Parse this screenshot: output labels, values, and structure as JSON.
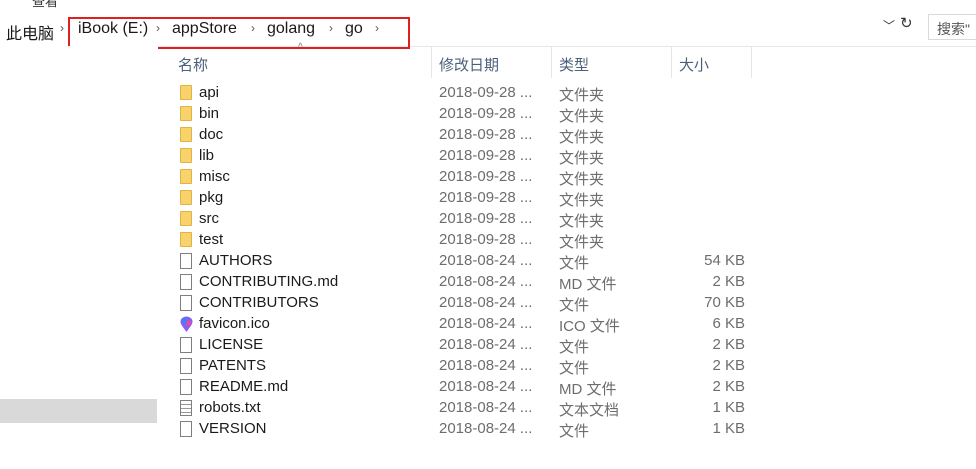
{
  "window": {
    "fragment": "查看"
  },
  "address": {
    "crumbs": [
      "此电脑",
      "iBook (E:)",
      "appStore",
      "golang",
      "go"
    ],
    "search_placeholder": "搜索\""
  },
  "columns": {
    "name": "名称",
    "date": "修改日期",
    "type": "类型",
    "size": "大小"
  },
  "files": [
    {
      "name": "api",
      "date": "2018-09-28 ...",
      "type": "文件夹",
      "size": "",
      "kind": "folder"
    },
    {
      "name": "bin",
      "date": "2018-09-28 ...",
      "type": "文件夹",
      "size": "",
      "kind": "folder"
    },
    {
      "name": "doc",
      "date": "2018-09-28 ...",
      "type": "文件夹",
      "size": "",
      "kind": "folder"
    },
    {
      "name": "lib",
      "date": "2018-09-28 ...",
      "type": "文件夹",
      "size": "",
      "kind": "folder"
    },
    {
      "name": "misc",
      "date": "2018-09-28 ...",
      "type": "文件夹",
      "size": "",
      "kind": "folder"
    },
    {
      "name": "pkg",
      "date": "2018-09-28 ...",
      "type": "文件夹",
      "size": "",
      "kind": "folder"
    },
    {
      "name": "src",
      "date": "2018-09-28 ...",
      "type": "文件夹",
      "size": "",
      "kind": "folder"
    },
    {
      "name": "test",
      "date": "2018-09-28 ...",
      "type": "文件夹",
      "size": "",
      "kind": "folder"
    },
    {
      "name": "AUTHORS",
      "date": "2018-08-24 ...",
      "type": "文件",
      "size": "54 KB",
      "kind": "file"
    },
    {
      "name": "CONTRIBUTING.md",
      "date": "2018-08-24 ...",
      "type": "MD 文件",
      "size": "2 KB",
      "kind": "file"
    },
    {
      "name": "CONTRIBUTORS",
      "date": "2018-08-24 ...",
      "type": "文件",
      "size": "70 KB",
      "kind": "file"
    },
    {
      "name": "favicon.ico",
      "date": "2018-08-24 ...",
      "type": "ICO 文件",
      "size": "6 KB",
      "kind": "ico"
    },
    {
      "name": "LICENSE",
      "date": "2018-08-24 ...",
      "type": "文件",
      "size": "2 KB",
      "kind": "file"
    },
    {
      "name": "PATENTS",
      "date": "2018-08-24 ...",
      "type": "文件",
      "size": "2 KB",
      "kind": "file"
    },
    {
      "name": "README.md",
      "date": "2018-08-24 ...",
      "type": "MD 文件",
      "size": "2 KB",
      "kind": "file"
    },
    {
      "name": "robots.txt",
      "date": "2018-08-24 ...",
      "type": "文本文档",
      "size": "1 KB",
      "kind": "txt"
    },
    {
      "name": "VERSION",
      "date": "2018-08-24 ...",
      "type": "文件",
      "size": "1 KB",
      "kind": "file"
    }
  ],
  "colors": {
    "highlight_border": "#e02020",
    "folder": "#f8d26a",
    "header_text": "#4c607a"
  }
}
